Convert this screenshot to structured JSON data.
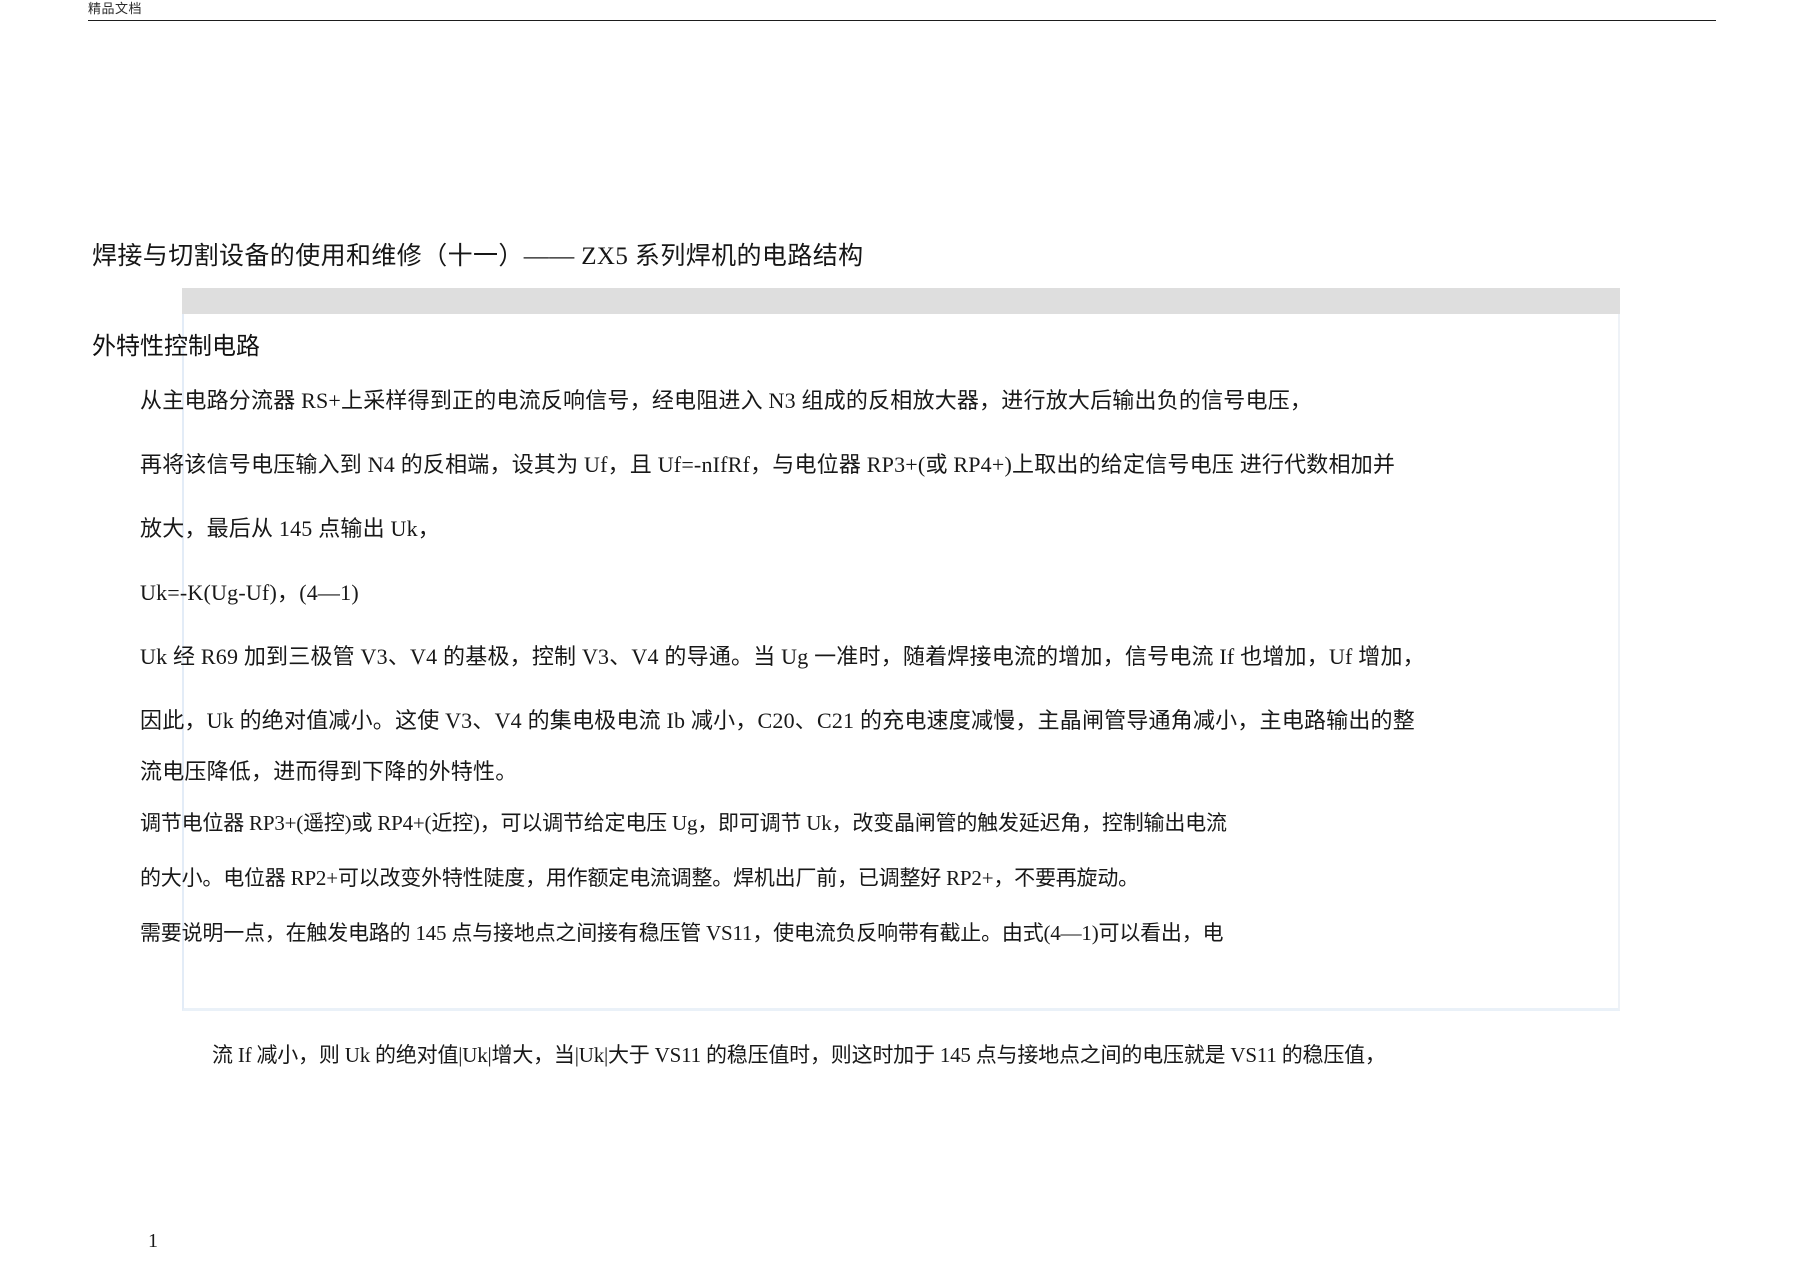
{
  "header": {
    "watermark_text": "精品文档"
  },
  "title": "焊接与切割设备的使用和维修（十一）——  ZX5 系列焊机的电路结构",
  "section": {
    "heading": "外特性控制电路"
  },
  "body": {
    "lines": [
      "从主电路分流器  RS+上采样得到正的电流反响信号，经电阻进入   N3 组成的反相放大器，进行放大后输出负的信号电压，",
      "再将该信号电压输入到   N4 的反相端，设其为 Uf，且 Uf=-nIfRf，与电位器 RP3+(或 RP4+)上取出的给定信号电压  进行代数相加并",
      "放大，最后从 145 点输出 Uk，",
      "Uk=-K(Ug-Uf)，(4—1)",
      "Uk 经 R69 加到三极管 V3、V4 的基极，控制 V3、V4 的导通。当 Ug 一准时，随着焊接电流的增加，信号电流   If   也增加，Uf 增加，",
      "因此，Uk 的绝对值减小。这使  V3、V4 的集电极电流  Ib 减小，C20、C21 的充电速度减慢，主晶闸管导通角减小，主电路输出的整",
      "流电压降低，进而得到下降的外特性。",
      "调节电位器 RP3+(遥控)或 RP4+(近控)，可以调节给定电压 Ug，即可调节 Uk，改变晶闸管的触发延迟角，控制输出电流",
      "的大小。电位器 RP2+可以改变外特性陡度，用作额定电流调整。焊机出厂前，已调整好   RP2+，不要再旋动。",
      "需要说明一点，在触发电路的  145 点与接地点之间接有稳压管 VS11，使电流负反响带有截止。由式(4—1)可以看出，电"
    ],
    "tail_line": "流 If   减小，则 Uk 的绝对值|Uk|增大，当|Uk|大于 VS11 的稳压值时，则这时加于  145 点与接地点之间的电压就是 VS11 的稳压值，"
  },
  "footer": {
    "page_number": "1"
  },
  "colors": {
    "band": "#dedede",
    "frame": "#e3ecf7",
    "text": "#181818",
    "rule": "#1d1d1d"
  }
}
